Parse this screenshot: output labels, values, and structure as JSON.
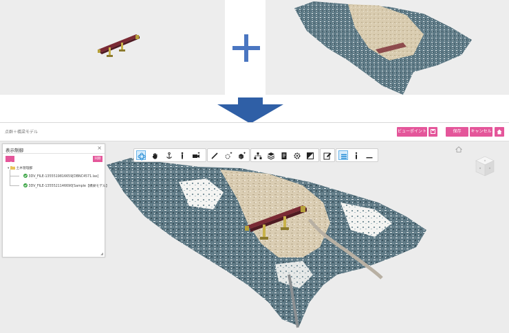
{
  "app": {
    "breadcrumb": "点群＋橋梁モデル",
    "buttons": {
      "viewpoint": "ビューポイント",
      "save": "保存",
      "cancel": "キャンセル"
    }
  },
  "display_panel": {
    "title": "表示制御",
    "sync_label": "同期",
    "tree": {
      "root": "土木管理部",
      "items": [
        "3DV_FILE-1355519816659[DBNC4571.las]",
        "3DV_FILE-1355521146690[Sample【橋梁モデル】"
      ]
    }
  },
  "toolbar": {
    "groups": [
      [
        "orbit-icon",
        "hand-pan-icon",
        "anchor-icon",
        "walk-person-icon",
        "camera-plus-icon"
      ],
      [
        "ruler-line-icon",
        "snap-plus-icon",
        "cube-plus-icon"
      ],
      [
        "hierarchy-icon",
        "layers-icon",
        "document-icon",
        "gear-icon",
        "contrast-icon"
      ],
      [
        "edit-icon"
      ],
      [
        "list-icon",
        "info-icon",
        "minimize-icon"
      ]
    ],
    "active": [
      "orbit-icon",
      "list-icon"
    ]
  },
  "colors": {
    "accent_pink": "#e4569a",
    "arrow_blue": "#2f5fa6",
    "plus_blue": "#4a76c1",
    "bridge_deck": "#7a2a34",
    "bridge_piers": "#c9b34a"
  }
}
